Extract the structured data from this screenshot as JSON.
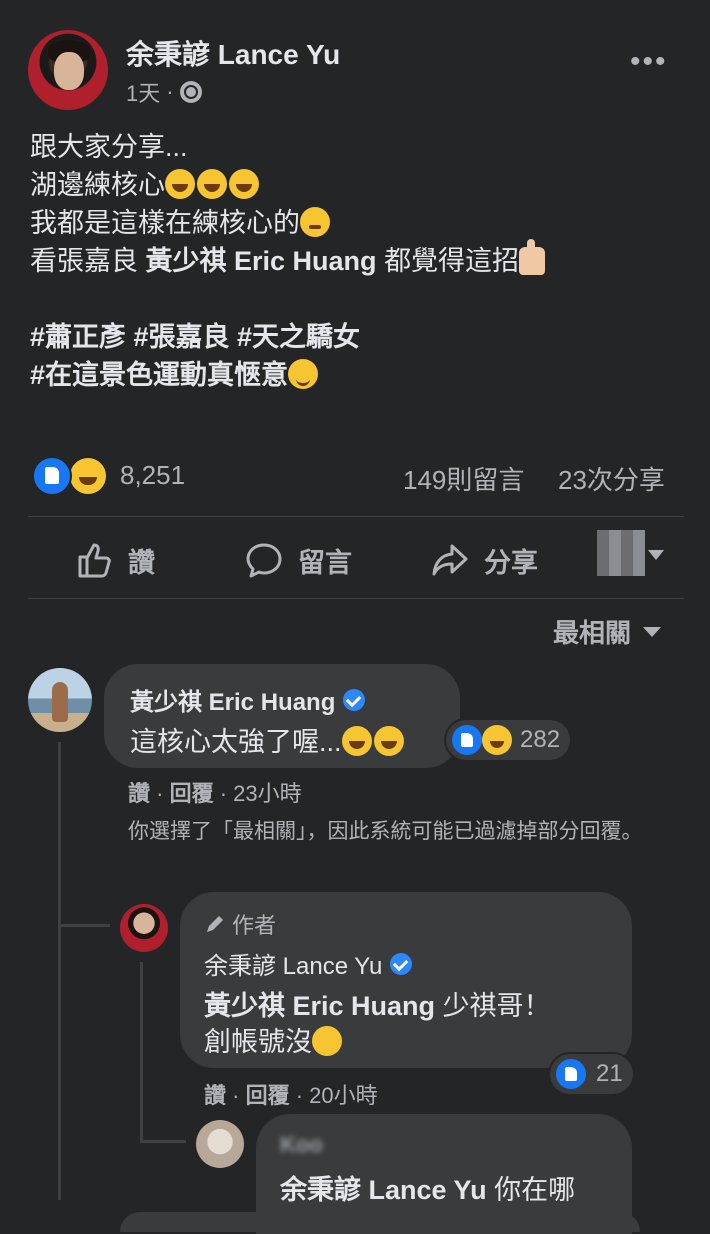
{
  "post": {
    "author": "余秉諺 Lance Yu",
    "time": "1天",
    "separator": "·",
    "more_label": "•••",
    "lines": [
      "跟大家分享...",
      "湖邊練核心",
      "我都是這樣在練核心的",
      "看張嘉良",
      "黃少祺 Eric Huang",
      "都覺得這招"
    ],
    "hashtags_line1": "#蕭正彥 #張嘉良 #天之驕女",
    "hashtags_line2": "#在這景色運動真愜意",
    "reaction_count": "8,251",
    "comment_count": "149則留言",
    "share_count": "23次分享"
  },
  "actions": {
    "like": "讚",
    "comment": "留言",
    "share": "分享"
  },
  "sort": {
    "label": "最相關"
  },
  "comments": [
    {
      "name": "黃少祺 Eric Huang",
      "text": "這核心太強了喔...",
      "reactions": "282",
      "like": "讚",
      "reply": "回覆",
      "time": "23小時",
      "notice": "你選擇了「最相關」，因此系統可能已過濾掉部分回覆。"
    },
    {
      "badge": "作者",
      "name": "余秉諺 Lance Yu",
      "mention": "黃少祺 Eric Huang",
      "text_a": " 少祺哥！",
      "text_b": "創帳號沒",
      "reactions": "21",
      "like": "讚",
      "reply": "回覆",
      "time": "20小時"
    },
    {
      "name": "Koo",
      "mention": "余秉諺 Lance Yu",
      "text": " 你在哪"
    }
  ],
  "icons": {
    "like": "thumbs-up-icon",
    "comment": "comment-bubble-icon",
    "share": "share-arrow-icon",
    "globe": "globe-icon",
    "verified": "verified-badge-icon",
    "author_badge": "pencil-icon"
  },
  "colors": {
    "background": "#242526",
    "bubble": "#3a3b3c",
    "like_blue": "#1877f2",
    "verified_blue": "#2d88ff",
    "secondary_text": "#b0b3b8"
  }
}
